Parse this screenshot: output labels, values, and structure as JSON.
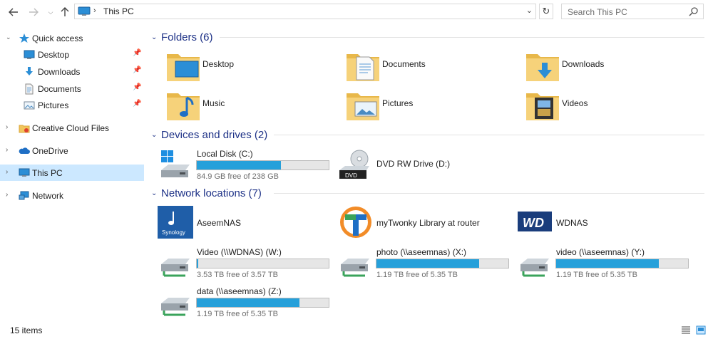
{
  "address": {
    "back_icon": "back-arrow-icon",
    "forward_icon": "forward-arrow-icon",
    "up_icon": "up-arrow-icon",
    "breadcrumb": "This PC",
    "search_placeholder": "Search This PC"
  },
  "sidebar": {
    "quick_access": "Quick access",
    "items": [
      {
        "label": "Desktop",
        "pinned": true
      },
      {
        "label": "Downloads",
        "pinned": true
      },
      {
        "label": "Documents",
        "pinned": true
      },
      {
        "label": "Pictures",
        "pinned": true
      }
    ],
    "creative_cloud": "Creative Cloud Files",
    "onedrive": "OneDrive",
    "this_pc": "This PC",
    "network": "Network"
  },
  "groups": {
    "folders": "Folders (6)",
    "devices": "Devices and drives (2)",
    "network": "Network locations (7)"
  },
  "folders": [
    {
      "name": "Desktop"
    },
    {
      "name": "Documents"
    },
    {
      "name": "Downloads"
    },
    {
      "name": "Music"
    },
    {
      "name": "Pictures"
    },
    {
      "name": "Videos"
    }
  ],
  "drives": [
    {
      "name": "Local Disk (C:)",
      "free": "84.9 GB free of 238 GB",
      "used_fraction": 0.64
    },
    {
      "name": "DVD RW Drive (D:)"
    }
  ],
  "network": [
    {
      "name": "AseemNAS"
    },
    {
      "name": "myTwonky Library at router"
    },
    {
      "name": "WDNAS"
    },
    {
      "name": "Video (\\\\WDNAS) (W:)",
      "free": "3.53 TB free of 3.57 TB",
      "used_fraction": 0.01
    },
    {
      "name": "photo (\\\\aseemnas) (X:)",
      "free": "1.19 TB free of 5.35 TB",
      "used_fraction": 0.78
    },
    {
      "name": "video (\\\\aseemnas) (Y:)",
      "free": "1.19 TB free of 5.35 TB",
      "used_fraction": 0.78
    },
    {
      "name": "data (\\\\aseemnas) (Z:)",
      "free": "1.19 TB free of 5.35 TB",
      "used_fraction": 0.78
    }
  ],
  "logos": {
    "synology": "Synology",
    "wd": "WD",
    "dvd": "DVD"
  },
  "status": {
    "count": "15 items"
  },
  "colors": {
    "accent": "#26a0da",
    "selected": "#cce8ff",
    "group_title": "#1e3287",
    "folder": "#f2c55c"
  }
}
